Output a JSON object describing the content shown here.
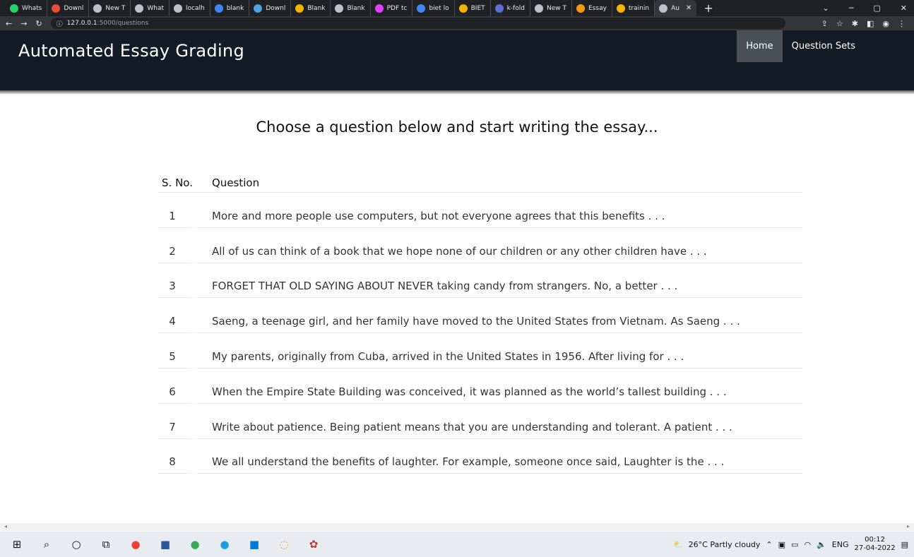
{
  "browser": {
    "tabs": [
      {
        "label": "Whats",
        "color": "#25d366"
      },
      {
        "label": "Downl",
        "color": "#e74c3c"
      },
      {
        "label": "New T",
        "color": "#bdc1c6"
      },
      {
        "label": "What",
        "color": "#bdc1c6"
      },
      {
        "label": "localh",
        "color": "#bdc1c6"
      },
      {
        "label": "blank",
        "color": "#4285f4"
      },
      {
        "label": "Downl",
        "color": "#4aa3df"
      },
      {
        "label": "Blank",
        "color": "#f4b400"
      },
      {
        "label": "Blank",
        "color": "#bdc1c6"
      },
      {
        "label": "PDF tc",
        "color": "#e040fb"
      },
      {
        "label": "biet lo",
        "color": "#4285f4"
      },
      {
        "label": "BIET",
        "color": "#f4b400"
      },
      {
        "label": "k-fold",
        "color": "#5b6fd6"
      },
      {
        "label": "New T",
        "color": "#bdc1c6"
      },
      {
        "label": "Essay",
        "color": "#f39c12"
      },
      {
        "label": "trainin",
        "color": "#f4b400"
      },
      {
        "label": "Au",
        "color": "#bdc1c6"
      }
    ],
    "new_tab": "+",
    "address": {
      "host": "127.0.0.1",
      "path": ":5000/questions"
    }
  },
  "app": {
    "brand": "Automated Essay Grading",
    "nav": [
      {
        "label": "Home",
        "active": true
      },
      {
        "label": "Question Sets",
        "active": false
      }
    ]
  },
  "main": {
    "heading": "Choose a question below and start writing the essay...",
    "columns": {
      "sno": "S. No.",
      "question": "Question"
    },
    "questions": [
      {
        "sno": "1",
        "text": "More and more people use computers, but not everyone agrees that this benefits . . ."
      },
      {
        "sno": "2",
        "text": "All of us can think of a book that we hope none of our children or any other children have . . ."
      },
      {
        "sno": "3",
        "text": "FORGET THAT OLD SAYING ABOUT NEVER taking candy from strangers. No, a better . . ."
      },
      {
        "sno": "4",
        "text": "Saeng, a teenage girl, and her family have moved to the United States from Vietnam. As Saeng . . ."
      },
      {
        "sno": "5",
        "text": "My parents, originally from Cuba, arrived in the United States in 1956. After living for . . ."
      },
      {
        "sno": "6",
        "text": "When the Empire State Building was conceived, it was planned as the world’s tallest building . . ."
      },
      {
        "sno": "7",
        "text": "Write about patience. Being patient means that you are understanding and tolerant. A patient . . ."
      },
      {
        "sno": "8",
        "text": "We all understand the benefits of laughter. For example, someone once said, Laughter is the . . ."
      }
    ]
  },
  "taskbar": {
    "weather": "26°C  Partly cloudy",
    "lang": "ENG",
    "time": "00:12",
    "date": "27-04-2022"
  }
}
